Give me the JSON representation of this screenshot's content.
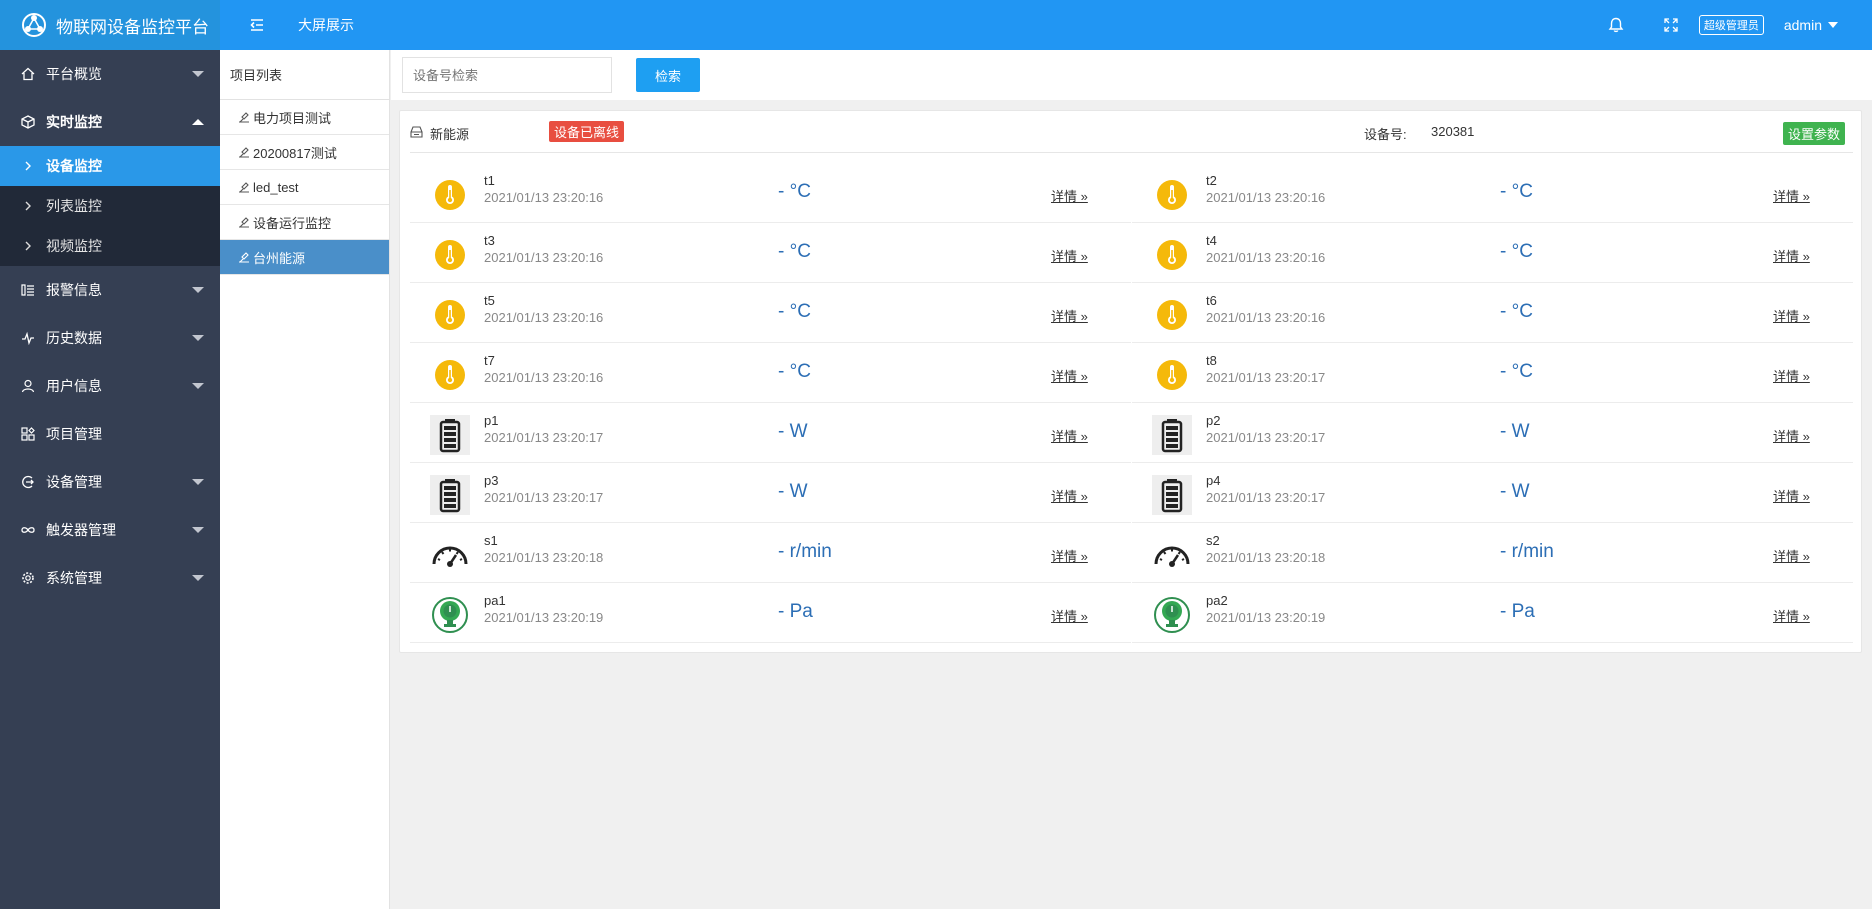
{
  "app": {
    "title": "物联网设备监控平台"
  },
  "topbar": {
    "big_screen": "大屏展示",
    "role": "超级管理员",
    "user": "admin"
  },
  "sidebar": {
    "items": [
      {
        "label": "平台概览"
      },
      {
        "label": "实时监控"
      },
      {
        "label": "报警信息"
      },
      {
        "label": "历史数据"
      },
      {
        "label": "用户信息"
      },
      {
        "label": "项目管理"
      },
      {
        "label": "设备管理"
      },
      {
        "label": "触发器管理"
      },
      {
        "label": "系统管理"
      }
    ],
    "sub_items": [
      {
        "label": "设备监控"
      },
      {
        "label": "列表监控"
      },
      {
        "label": "视频监控"
      }
    ]
  },
  "projects": {
    "header": "项目列表",
    "items": [
      {
        "label": "电力项目测试"
      },
      {
        "label": "20200817测试"
      },
      {
        "label": "led_test"
      },
      {
        "label": "设备运行监控"
      },
      {
        "label": "台州能源"
      }
    ]
  },
  "search": {
    "placeholder": "设备号检索",
    "button": "检索"
  },
  "device": {
    "name": "新能源",
    "status": "设备已离线",
    "number_label": "设备号:",
    "number": "320381",
    "settings_button": "设置参数",
    "detail_label": "详情 »",
    "sensors_left": [
      {
        "name": "t1",
        "time": "2021/01/13 23:20:16",
        "value": "- °C",
        "icon": "thermometer-icon"
      },
      {
        "name": "t3",
        "time": "2021/01/13 23:20:16",
        "value": "- °C",
        "icon": "thermometer-icon"
      },
      {
        "name": "t5",
        "time": "2021/01/13 23:20:16",
        "value": "- °C",
        "icon": "thermometer-icon"
      },
      {
        "name": "t7",
        "time": "2021/01/13 23:20:16",
        "value": "- °C",
        "icon": "thermometer-icon"
      },
      {
        "name": "p1",
        "time": "2021/01/13 23:20:17",
        "value": "- W",
        "icon": "battery-icon"
      },
      {
        "name": "p3",
        "time": "2021/01/13 23:20:17",
        "value": "- W",
        "icon": "battery-icon"
      },
      {
        "name": "s1",
        "time": "2021/01/13 23:20:18",
        "value": "- r/min",
        "icon": "gauge-icon"
      },
      {
        "name": "pa1",
        "time": "2021/01/13 23:20:19",
        "value": "- Pa",
        "icon": "pressure-icon"
      }
    ],
    "sensors_right": [
      {
        "name": "t2",
        "time": "2021/01/13 23:20:16",
        "value": "- °C",
        "icon": "thermometer-icon"
      },
      {
        "name": "t4",
        "time": "2021/01/13 23:20:16",
        "value": "- °C",
        "icon": "thermometer-icon"
      },
      {
        "name": "t6",
        "time": "2021/01/13 23:20:16",
        "value": "- °C",
        "icon": "thermometer-icon"
      },
      {
        "name": "t8",
        "time": "2021/01/13 23:20:17",
        "value": "- °C",
        "icon": "thermometer-icon"
      },
      {
        "name": "p2",
        "time": "2021/01/13 23:20:17",
        "value": "- W",
        "icon": "battery-icon"
      },
      {
        "name": "p4",
        "time": "2021/01/13 23:20:17",
        "value": "- W",
        "icon": "battery-icon"
      },
      {
        "name": "s2",
        "time": "2021/01/13 23:20:18",
        "value": "- r/min",
        "icon": "gauge-icon"
      },
      {
        "name": "pa2",
        "time": "2021/01/13 23:20:19",
        "value": "- Pa",
        "icon": "pressure-icon"
      }
    ]
  },
  "colors": {
    "topbar": "#2196f3",
    "sidebar": "#353f53",
    "active_sub": "#2a98e8",
    "offline": "#e84e40",
    "settings": "#3fb34f",
    "value": "#2c6eb5"
  }
}
